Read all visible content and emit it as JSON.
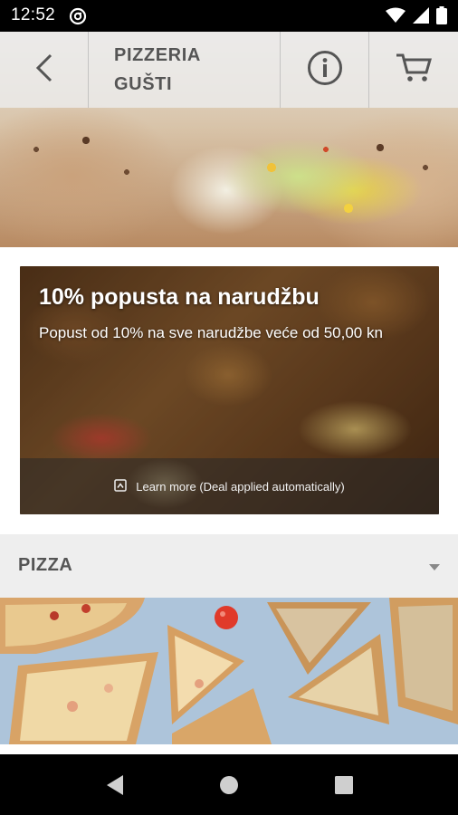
{
  "status_bar": {
    "time": "12:52",
    "icons": [
      "do-not-disturb-icon",
      "wifi-icon",
      "signal-icon",
      "battery-icon"
    ]
  },
  "header": {
    "title_line1": "PIZZERIA",
    "title_line2": "GUŠTI",
    "icons": [
      "back-arrow-icon",
      "info-icon",
      "cart-icon"
    ]
  },
  "deal": {
    "title": "10% popusta na narudžbu",
    "description": "Popust od 10% na sve narudžbe veće od 50,00 kn",
    "learn_more": "Learn more (Deal applied automatically)"
  },
  "menu": {
    "section_label": "PIZZA"
  },
  "colors": {
    "status_bar_bg": "#000000",
    "topbar_bg": "#ebebeb",
    "section_bg": "#eeeeee",
    "title_text": "#555555"
  },
  "nav_bar": {
    "icons": [
      "back-icon",
      "home-icon",
      "recents-icon"
    ]
  }
}
